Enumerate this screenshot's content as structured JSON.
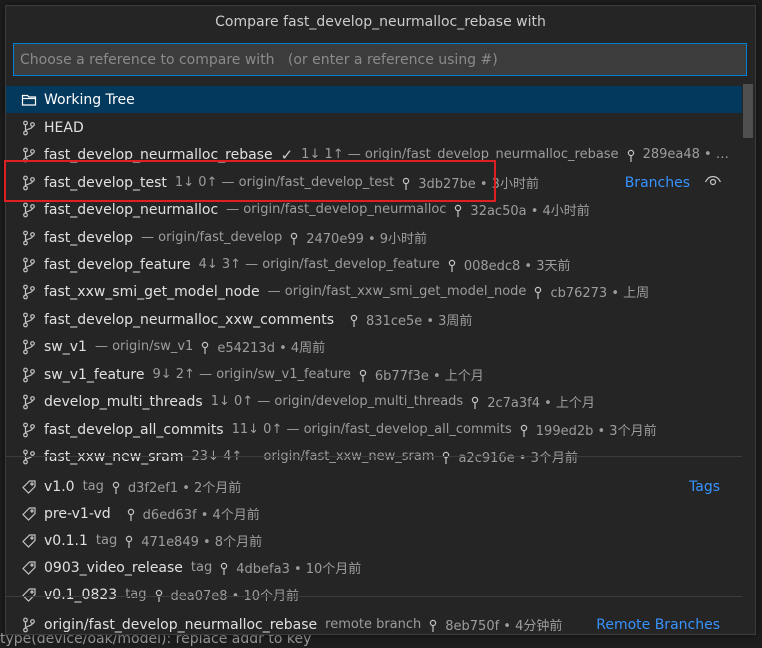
{
  "title": "Compare fast_develop_neurmalloc_rebase with",
  "input": {
    "placeholder": "Choose a reference to compare with   (or enter a reference using #)"
  },
  "items": [
    {
      "name": "Working Tree",
      "icon": "folder-icon",
      "desc": "",
      "selected": true
    },
    {
      "name": "HEAD",
      "icon": "branch-icon",
      "desc": ""
    },
    {
      "name": "fast_develop_neurmalloc_rebase",
      "icon": "branch-icon",
      "check": "✓",
      "desc": "1↓ 1↑ — origin/fast_develop_neurmalloc_rebase",
      "sha": "289ea48",
      "age": "…"
    },
    {
      "name": "fast_develop_test",
      "icon": "branch-icon",
      "desc": "1↓ 0↑ — origin/fast_develop_test",
      "sha": "3db27be",
      "age": "3小时前",
      "group": "Branches"
    },
    {
      "name": "fast_develop_neurmalloc",
      "icon": "branch-icon",
      "desc": "— origin/fast_develop_neurmalloc",
      "sha": "32ac50a",
      "age": "4小时前"
    },
    {
      "name": "fast_develop",
      "icon": "branch-icon",
      "desc": "— origin/fast_develop",
      "sha": "2470e99",
      "age": "9小时前"
    },
    {
      "name": "fast_develop_feature",
      "icon": "branch-icon",
      "desc": "4↓ 3↑ — origin/fast_develop_feature",
      "sha": "008edc8",
      "age": "3天前"
    },
    {
      "name": "fast_xxw_smi_get_model_node",
      "icon": "branch-icon",
      "desc": "— origin/fast_xxw_smi_get_model_node",
      "sha": "cb76273",
      "age": "上周"
    },
    {
      "name": "fast_develop_neurmalloc_xxw_comments",
      "icon": "branch-icon",
      "desc": "",
      "sha": "831ce5e",
      "age": "3周前"
    },
    {
      "name": "sw_v1",
      "icon": "branch-icon",
      "desc": "— origin/sw_v1",
      "sha": "e54213d",
      "age": "4周前"
    },
    {
      "name": "sw_v1_feature",
      "icon": "branch-icon",
      "desc": "9↓ 2↑ — origin/sw_v1_feature",
      "sha": "6b77f3e",
      "age": "上个月"
    },
    {
      "name": "develop_multi_threads",
      "icon": "branch-icon",
      "desc": "1↓ 0↑ — origin/develop_multi_threads",
      "sha": "2c7a3f4",
      "age": "上个月"
    },
    {
      "name": "fast_develop_all_commits",
      "icon": "branch-icon",
      "desc": "11↓ 0↑ — origin/fast_develop_all_commits",
      "sha": "199ed2b",
      "age": "3个月前"
    },
    {
      "name": "fast_xxw_new_sram",
      "icon": "branch-icon",
      "desc": "23↓ 4↑ — origin/fast_xxw_new_sram",
      "sha": "a2c916e",
      "age": "3个月前"
    },
    {
      "name": "v1.0",
      "icon": "tag-icon",
      "desc": "tag",
      "sha": "d3f2ef1",
      "age": "2个月前",
      "group": "Tags"
    },
    {
      "name": "pre-v1-vd",
      "icon": "tag-icon",
      "desc": "",
      "sha": "d6ed63f",
      "age": "4个月前"
    },
    {
      "name": "v0.1.1",
      "icon": "tag-icon",
      "desc": "tag",
      "sha": "471e849",
      "age": "8个月前"
    },
    {
      "name": "0903_video_release",
      "icon": "tag-icon",
      "desc": "tag",
      "sha": "4dbefa3",
      "age": "10个月前"
    },
    {
      "name": "v0.1_0823",
      "icon": "tag-icon",
      "desc": "tag",
      "sha": "dea07e8",
      "age": "10个月前"
    },
    {
      "name": "origin/fast_develop_neurmalloc_rebase",
      "icon": "branch-icon",
      "desc": "remote branch",
      "sha": "8eb750f",
      "age": "4分钟前",
      "group": "Remote Branches"
    }
  ],
  "bottom_text": "type(device/oak/model): replace addr to key"
}
